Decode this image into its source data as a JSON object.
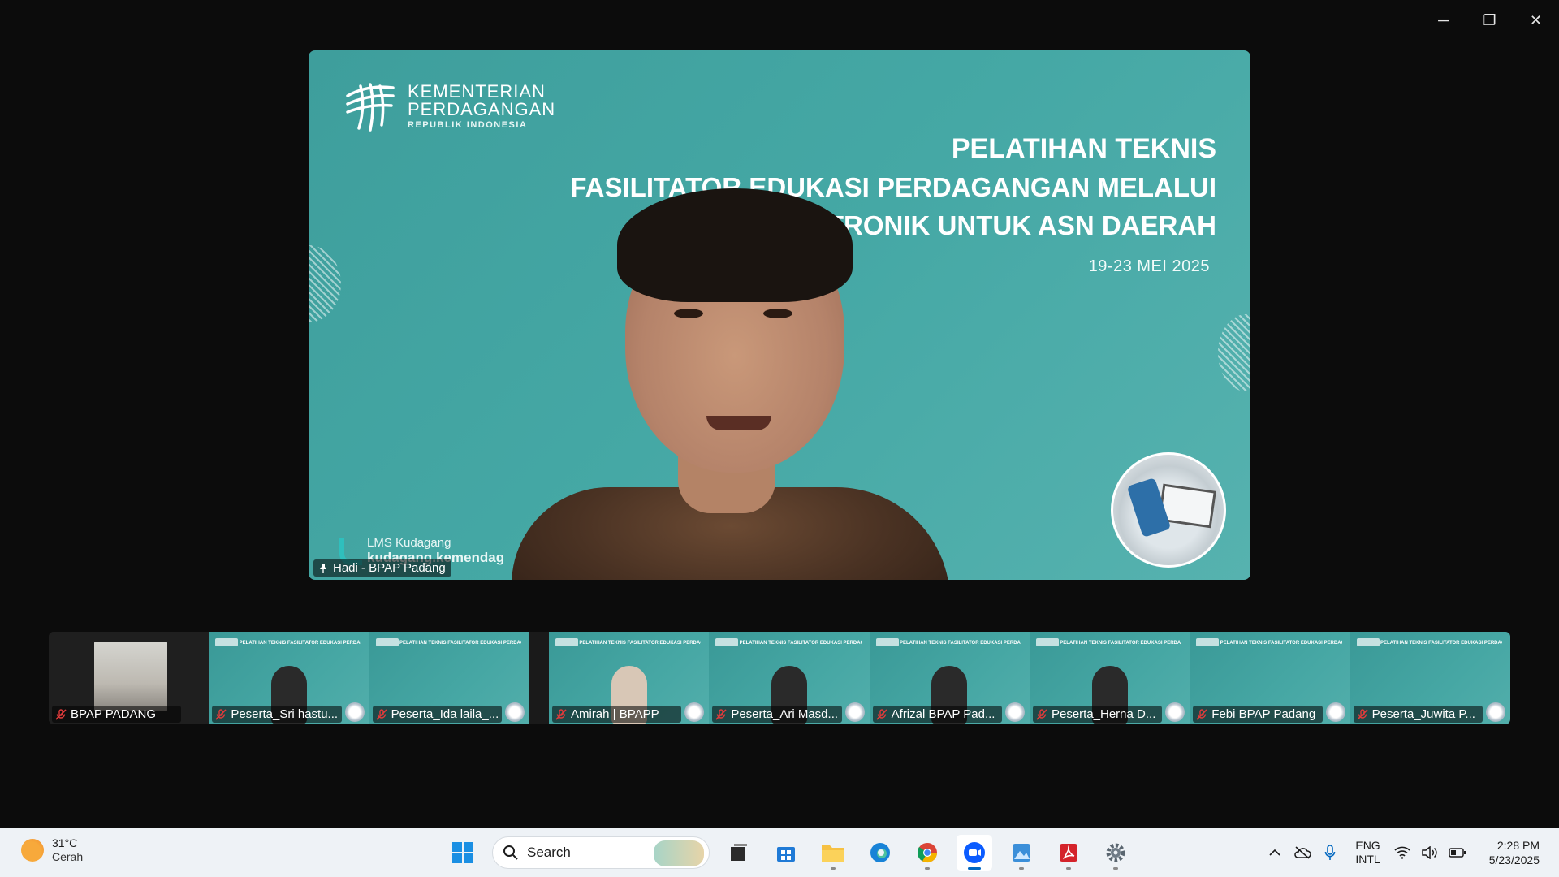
{
  "window_controls": {
    "minimize": "─",
    "restore": "❐",
    "close": "✕"
  },
  "main_video": {
    "slide": {
      "logo_line1": "KEMENTERIAN",
      "logo_line2": "PERDAGANGAN",
      "logo_line3": "REPUBLIK INDONESIA",
      "title_line1": "PELATIHAN TEKNIS",
      "title_line2": "FASILITATOR EDUKASI PERDAGANGAN MELALUI",
      "title_line3": "SISTEM ELEKTRONIK UNTUK ASN DAERAH",
      "date": "19-23 MEI 2025",
      "lms_line1": "LMS Kudagang",
      "lms_line2": "kudagang.kemendag"
    },
    "presenter_name": "Hadi - BPAP Padang"
  },
  "participants": [
    {
      "name": "BPAP PADANG",
      "kind": "room"
    },
    {
      "name": "Peserta_Sri hastu...",
      "kind": "slide-person"
    },
    {
      "name": "Peserta_Ida laila_...",
      "kind": "slide"
    },
    {
      "name": "Amirah | BPAPP",
      "kind": "slide-person-light"
    },
    {
      "name": "Peserta_Ari Masd...",
      "kind": "slide-person"
    },
    {
      "name": "Afrizal BPAP Pad...",
      "kind": "slide-person"
    },
    {
      "name": "Peserta_Herna D...",
      "kind": "slide-person"
    },
    {
      "name": "Febi BPAP Padang",
      "kind": "slide"
    },
    {
      "name": "Peserta_Juwita P...",
      "kind": "slide"
    }
  ],
  "mini_slide_title": "PELATIHAN TEKNIS FASILITATOR EDUKASI PERDAGANGAN MELALUI SISTEM ELEKTRONIK UNTUK ASN DAERAH",
  "taskbar": {
    "weather_temp": "31°C",
    "weather_cond": "Cerah",
    "search_label": "Search",
    "lang_line1": "ENG",
    "lang_line2": "INTL",
    "time": "2:28 PM",
    "date": "5/23/2025"
  }
}
